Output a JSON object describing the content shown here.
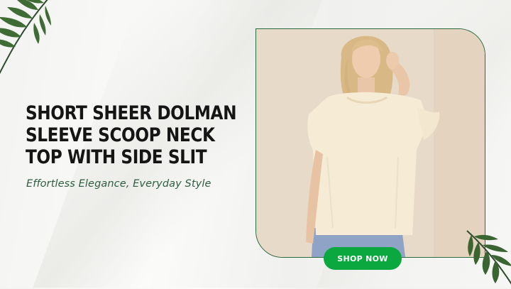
{
  "hero": {
    "headline_lines": [
      "SHORT SHEER DOLMAN",
      "SLEEVE SCOOP NECK",
      "TOP WITH SIDE SLIT"
    ],
    "tagline": "Effortless Elegance, Everyday Style",
    "cta_label": "SHOP NOW"
  },
  "icons": {
    "decoration_top_left": "palm-leaf-icon",
    "decoration_bottom_right": "palm-leaf-icon"
  },
  "colors": {
    "accent_green": "#0aa83f",
    "frame_green": "#2a6a3c",
    "headline": "#151515",
    "tagline": "#2e5d3f"
  }
}
